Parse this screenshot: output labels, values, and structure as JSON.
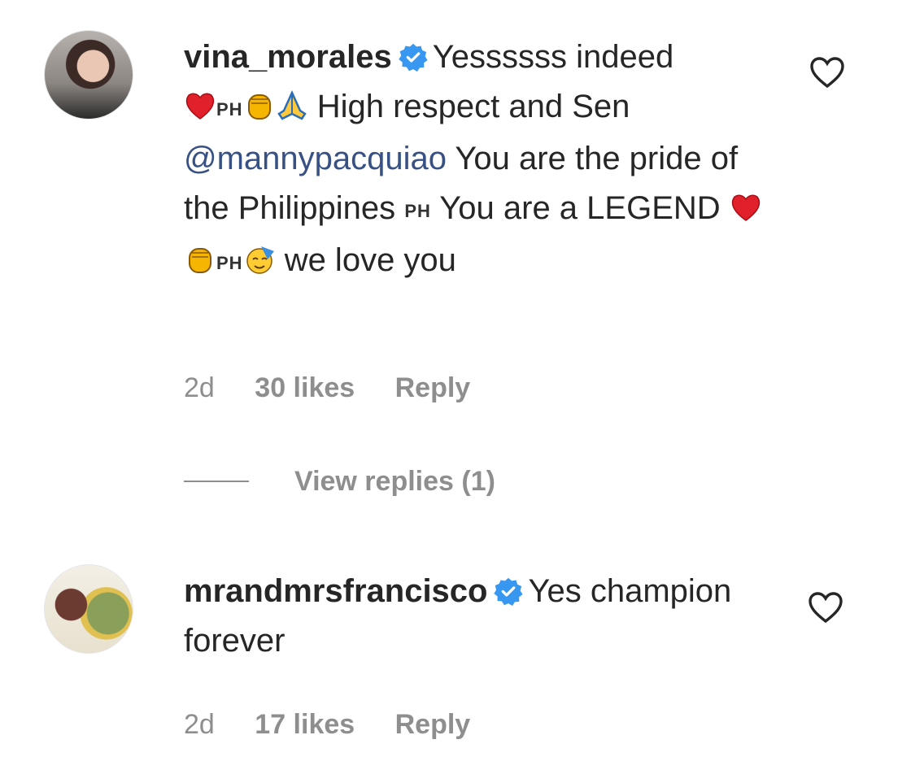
{
  "comments": [
    {
      "username": "vina_morales",
      "text_parts": {
        "a": "Yessssss indeed",
        "flag1": "PH",
        "b": "High respect and Sen",
        "mention": "@mannypacquiao",
        "c": "You are the pride of the Philippines",
        "flag2": "PH",
        "d": "You are a LEGEND",
        "flag3": "PH",
        "e": "we love you"
      },
      "time": "2d",
      "likes": "30 likes",
      "reply": "Reply",
      "view_replies": "View replies (1)"
    },
    {
      "username": "mrandmrsfrancisco",
      "text": "Yes champion forever",
      "time": "2d",
      "likes": "17 likes",
      "reply": "Reply"
    }
  ],
  "icons": [
    "verified-badge-icon",
    "heart-outline-icon",
    "red-heart-emoji",
    "raised-fist-emoji",
    "folded-hands-emoji",
    "partying-face-emoji"
  ],
  "colors": {
    "verified": "#3897f0",
    "mention": "#385185",
    "meta": "#8e8e8e",
    "text": "#262626"
  }
}
